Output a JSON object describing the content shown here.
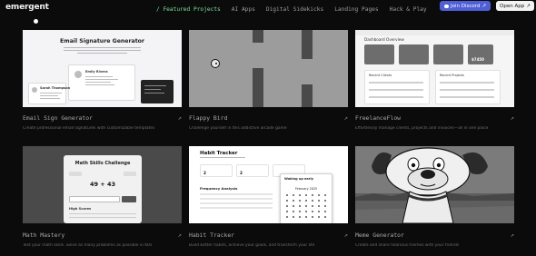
{
  "brand": {
    "logo": "emergent"
  },
  "nav": {
    "items": [
      {
        "label": "/ Featured Projects",
        "active": true
      },
      {
        "label": "AI Apps",
        "active": false
      },
      {
        "label": "Digital Sidekicks",
        "active": false
      },
      {
        "label": "Landing Pages",
        "active": false
      },
      {
        "label": "Hack & Play",
        "active": false
      }
    ]
  },
  "header_buttons": {
    "discord_label": "Join Discord",
    "open_app_label": "Open App"
  },
  "colors": {
    "accent_green": "#7de29a",
    "discord": "#4f5fd6"
  },
  "projects": [
    {
      "title": "Email Sign Generator",
      "description": "Create professional email signatures with customizable templates",
      "thumb": {
        "heading": "Email Signature Generator",
        "name": "Emily Rivera",
        "name2": "Sarah Thompson"
      }
    },
    {
      "title": "Flappy Bird",
      "description": "Challenge yourself in this addictive arcade game"
    },
    {
      "title": "FreelanceFlow",
      "description": "Effortlessly manage clients, projects and invoices—all in one place",
      "thumb": {
        "heading": "Dashboard Overview",
        "stat_value": "$7450",
        "recent_clients": "Recent Clients",
        "recent_projects": "Recent Projects"
      }
    },
    {
      "title": "Math Mastery",
      "description": "Test your math skills. Solve as many problems as possible in 60s",
      "thumb": {
        "heading": "Math Skills Challenge",
        "equation": "49 + 43",
        "high_scores": "High Scores"
      }
    },
    {
      "title": "Habit Tracker",
      "description": "Build better habits, achieve your goals, and transform your life",
      "thumb": {
        "heading": "Habit Tracker",
        "stat1": "2",
        "stat2": "2",
        "frequency": "Frequency Analysis",
        "calendar_title": "Waking up early",
        "calendar_month": "February 2025"
      }
    },
    {
      "title": "Meme Generator",
      "description": "Create and share hilarious memes with your friends"
    }
  ]
}
